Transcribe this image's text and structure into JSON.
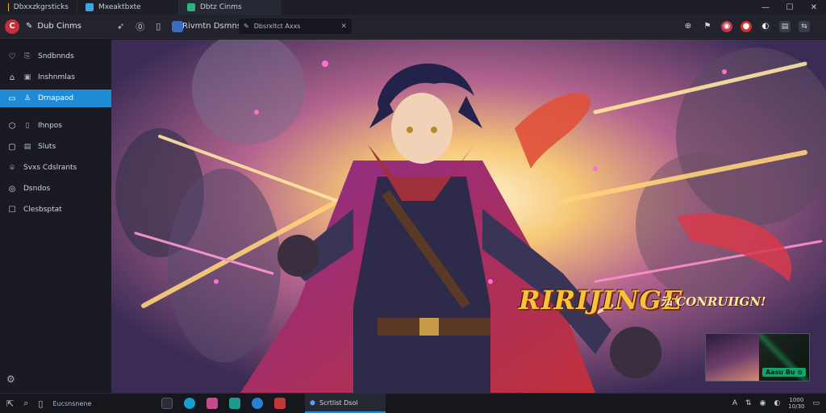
{
  "tabs": [
    {
      "label": "Dbxxzkgrsticks",
      "color": "#e0b23a"
    },
    {
      "label": "Mxeaktbxte",
      "color": "#3aa7e0"
    },
    {
      "label": "Dbtz Cinms",
      "color": "#2fb07c"
    }
  ],
  "window_controls": {
    "minimize": "—",
    "maximize": "☐",
    "close": "✕"
  },
  "toolbar": {
    "app_name": "Dub Cinms",
    "page_label": "Rivmtn Dsmns",
    "address": "Dbsrxltct Axxs",
    "logo_letter": "C"
  },
  "sidebar": {
    "items": [
      {
        "label": "Sndbnnds",
        "icon": "♡",
        "active": false
      },
      {
        "label": "Inshnmlas",
        "icon": "⌂",
        "active": false
      },
      {
        "label": "Drnapaod",
        "icon": "▭",
        "active": true
      },
      {
        "label": "Ihnpos",
        "icon": "⬡",
        "active": false
      },
      {
        "label": "Sluts",
        "icon": "▢",
        "active": false
      },
      {
        "label": "Svxs Cdslrants",
        "icon": "⌾",
        "active": false
      },
      {
        "label": "Dsndos",
        "icon": "◎",
        "active": false
      },
      {
        "label": "Clesbsptat",
        "icon": "☐",
        "active": false
      }
    ],
    "settings_icon": "⚙"
  },
  "artwork": {
    "title": "RIRIJINGE",
    "subtitle": "ﾗﾑ CONRUIIGN!",
    "pip_label": "Aasu Bu ⊙"
  },
  "taskbar": {
    "search_text": "Eucsnsnene",
    "active_app": "Scrtlist Dsol",
    "app_colors": [
      "#2a2c38",
      "#14a0c8",
      "#c64a8a",
      "#1c9c8c",
      "#2b7fd6",
      "#c23838"
    ],
    "clock_time": "1000",
    "clock_date": "10/30"
  },
  "colors": {
    "accent": "#1f8ad6",
    "brand": "#c62f3a",
    "title": "#f6c33b"
  }
}
